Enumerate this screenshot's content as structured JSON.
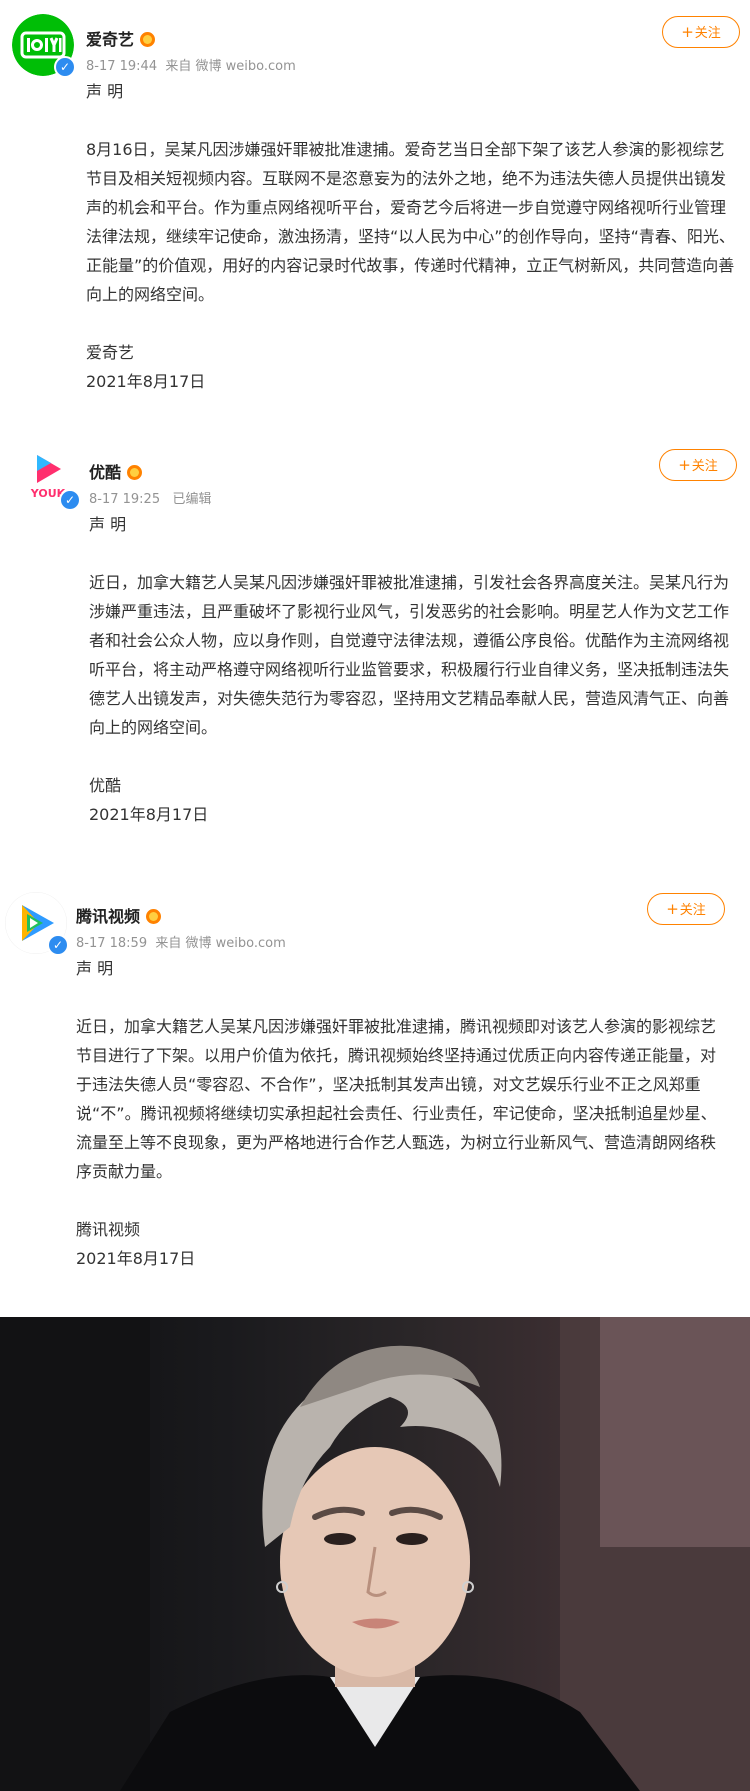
{
  "posts": [
    {
      "author": "爱奇艺",
      "time": "8-17 19:44",
      "source": "来自 微博 weibo.com",
      "follow_label": "关注",
      "title": "声 明",
      "paragraphs": [
        "8月16日，吴某凡因涉嫌强奸罪被批准逮捕。爱奇艺当日全部下架了该艺人参演的影视综艺节目及相关短视频内容。互联网不是恣意妄为的法外之地，绝不为违法失德人员提供出镜发声的机会和平台。作为重点网络视听平台，爱奇艺今后将进一步自觉遵守网络视听行业管理法律法规，继续牢记使命，激浊扬清，坚持“以人民为中心”的创作导向，坚持“青春、阳光、正能量”的价值观，用好的内容记录时代故事，传递时代精神，立正气树新风，共同营造向善向上的网络空间。"
      ],
      "signature": "爱奇艺",
      "date": "2021年8月17日",
      "brand_color": "#00be06"
    },
    {
      "author": "优酷",
      "time": "8-17 19:25",
      "source": "已编辑",
      "follow_label": "关注",
      "title": "声 明",
      "paragraphs": [
        "近日，加拿大籍艺人吴某凡因涉嫌强奸罪被批准逮捕，引发社会各界高度关注。吴某凡行为涉嫌严重违法，且严重破坏了影视行业风气，引发恶劣的社会影响。明星艺人作为文艺工作者和社会公众人物，应以身作则，自觉遵守法律法规，遵循公序良俗。优酷作为主流网络视听平台，将主动严格遵守网络视听行业监管要求，积极履行行业自律义务，坚决抵制违法失德艺人出镜发声，对失德失范行为零容忍，坚持用文艺精品奉献人民，营造风清气正、向善向上的网络空间。"
      ],
      "signature": "优酷",
      "date": "2021年8月17日",
      "brand_color": "#ff2f6e"
    },
    {
      "author": "腾讯视频",
      "time": "8-17 18:59",
      "source": "来自 微博 weibo.com",
      "follow_label": "关注",
      "title": "声 明",
      "paragraphs": [
        "近日，加拿大籍艺人吴某凡因涉嫌强奸罪被批准逮捕，腾讯视频即对该艺人参演的影视综艺节目进行了下架。以用户价值为依托，腾讯视频始终坚持通过优质正向内容传递正能量，对于违法失德人员“零容忍、不合作”，坚决抵制其发声出镜，对文艺娱乐行业不正之风郑重说“不”。腾讯视频将继续切实承担起社会责任、行业责任，牢记使命，坚决抵制追星炒星、流量至上等不良现象，更为严格地进行合作艺人甄选，为树立行业新风气、营造清朗网络秩序贡献力量。"
      ],
      "signature": "腾讯视频",
      "date": "2021年8月17日",
      "brand_color": "#2e9bff"
    }
  ],
  "icons": {
    "verified": "verified-badge-icon",
    "crown": "vip-crown-icon",
    "plus": "plus-icon"
  },
  "colors": {
    "accent": "#ff8200",
    "meta": "#939393",
    "verified": "#2d8cf0"
  }
}
